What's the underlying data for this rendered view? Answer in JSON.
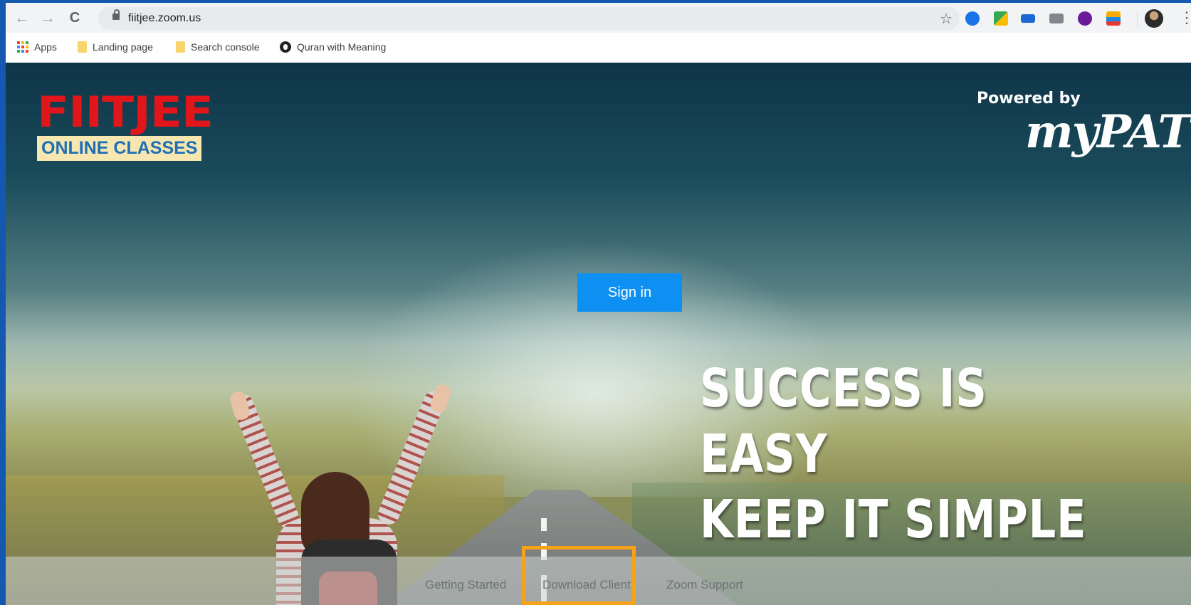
{
  "browser": {
    "url": "fiitjee.zoom.us",
    "nav": {
      "back": "←",
      "forward": "→",
      "reload": "C"
    },
    "star": "☆",
    "menu": "⋮",
    "bookmarks": [
      {
        "label": "Apps",
        "icon": "apps-grid-icon"
      },
      {
        "label": "Landing page",
        "icon": "folder-icon"
      },
      {
        "label": "Search console",
        "icon": "folder-icon"
      },
      {
        "label": "Quran with Meaning",
        "icon": "quran-icon"
      }
    ],
    "extensions": [
      "bus-icon",
      "maps-icon",
      "zip-icon",
      "camera-icon",
      "download-icon",
      "sitemap-icon"
    ]
  },
  "page": {
    "logo_word": "FIITJEE",
    "logo_sub": "ONLINE CLASSES",
    "powered_by": "Powered by",
    "brand": "myPAT",
    "sign_in": "Sign in",
    "tagline_line1": "SUCCESS IS EASY",
    "tagline_line2": "KEEP IT SIMPLE",
    "footer_links": [
      "Getting Started",
      "Download Client",
      "Zoom Support"
    ]
  },
  "colors": {
    "accent": "#0e8ff2",
    "logo_red": "#e1161a",
    "highlight": "#f7a21b"
  }
}
